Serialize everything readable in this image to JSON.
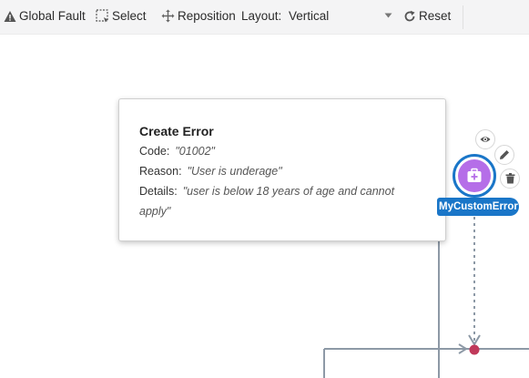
{
  "toolbar": {
    "global_fault": "Global Fault",
    "select": "Select",
    "reposition": "Reposition",
    "layout_label": "Layout:",
    "layout_value": "Vertical",
    "reset": "Reset"
  },
  "popup": {
    "title": "Create Error",
    "code_label": "Code:",
    "code_value": "\"01002\"",
    "reason_label": "Reason:",
    "reason_value": "\"User is underage\"",
    "details_label": "Details:",
    "details_value": "\"user is below 18 years of age and cannot apply\""
  },
  "node": {
    "label": "MyCustomError",
    "icon": "error-case-icon",
    "color": "#b56ee8",
    "ring_color": "#1a76c8"
  },
  "node_actions": [
    {
      "name": "view",
      "icon": "eye-icon"
    },
    {
      "name": "edit",
      "icon": "pencil-icon"
    },
    {
      "name": "delete",
      "icon": "trash-icon"
    }
  ],
  "colors": {
    "edge": "#8d99a6",
    "junction": "#c0395a"
  }
}
